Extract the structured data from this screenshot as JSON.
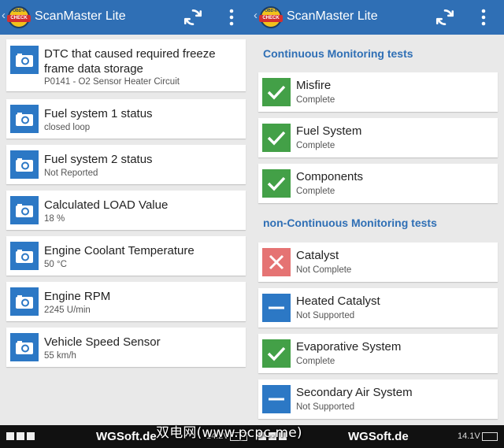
{
  "app": {
    "title": "ScanMaster Lite",
    "logo_top": "OBD-II",
    "logo_main": "CHECK",
    "back_glyph": "‹",
    "icons": {
      "refresh": "refresh-icon",
      "menu": "overflow-menu-icon",
      "freeze_frame": "camera-icon"
    },
    "colors": {
      "appbar": "#2f6fb5",
      "icon_blue": "#2c78c5",
      "check_green": "#43a047",
      "fail_red": "#e57373"
    }
  },
  "left": {
    "items": [
      {
        "title": "DTC that caused required freeze frame data storage",
        "value": "P0141 - O2 Sensor Heater Circuit"
      },
      {
        "title": "Fuel system 1 status",
        "value": "closed loop"
      },
      {
        "title": "Fuel system 2 status",
        "value": "Not Reported"
      },
      {
        "title": "Calculated LOAD Value",
        "value": "18 %"
      },
      {
        "title": "Engine Coolant Temperature",
        "value": "50 °C"
      },
      {
        "title": "Engine RPM",
        "value": "2245 U/min"
      },
      {
        "title": "Vehicle Speed Sensor",
        "value": "55 km/h"
      }
    ]
  },
  "right": {
    "continuous_header": "Continuous Monitoring tests",
    "continuous": [
      {
        "title": "Misfire",
        "status": "Complete",
        "icon": "check-icon"
      },
      {
        "title": "Fuel System",
        "status": "Complete",
        "icon": "check-icon"
      },
      {
        "title": "Components",
        "status": "Complete",
        "icon": "check-icon"
      }
    ],
    "noncontinuous_header": "non-Continuous Monitoring tests",
    "noncontinuous": [
      {
        "title": "Catalyst",
        "status": "Not Complete",
        "icon": "cross-icon"
      },
      {
        "title": "Heated Catalyst",
        "status": "Not Supported",
        "icon": "dash-icon"
      },
      {
        "title": "Evaporative System",
        "status": "Complete",
        "icon": "check-icon"
      },
      {
        "title": "Secondary Air System",
        "status": "Not Supported",
        "icon": "dash-icon"
      }
    ]
  },
  "statusbar": {
    "brand_left": "WGSoft.de",
    "brand_right": "WGSoft.de",
    "voltage_left": "14.2V",
    "voltage_right": "14.1V",
    "watermark": "双电网(www.pcpc.me)"
  }
}
